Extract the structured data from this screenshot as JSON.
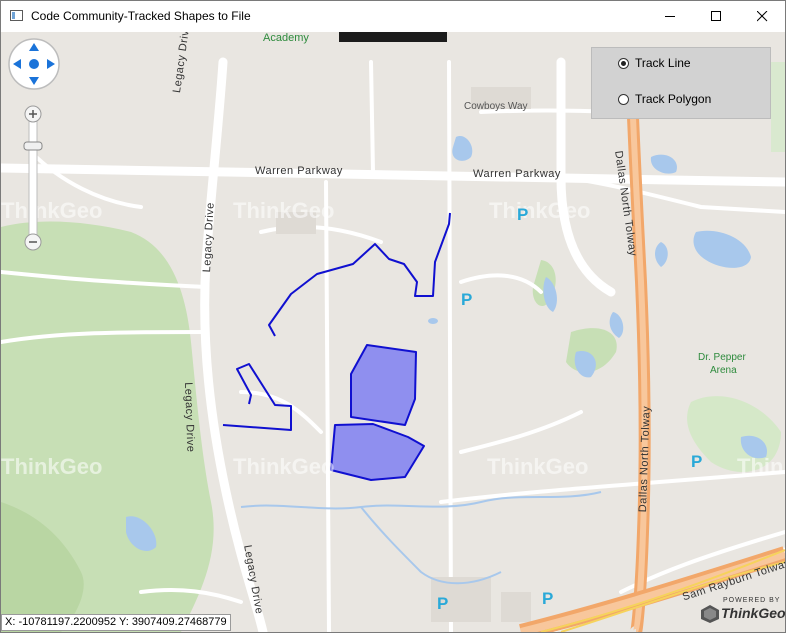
{
  "window": {
    "title": "Code Community-Tracked Shapes to File"
  },
  "track_panel": {
    "options": [
      {
        "label": "Track Line",
        "selected": true
      },
      {
        "label": "Track Polygon",
        "selected": false
      }
    ]
  },
  "map": {
    "roads": {
      "legacy_drive_1": "Legacy Drive",
      "legacy_drive_2": "Legacy Drive",
      "legacy_drive_3": "Legacy Drive",
      "legacy_drive_4": "Legacy Drive",
      "warren_parkway_1": "Warren Parkway",
      "warren_parkway_2": "Warren Parkway",
      "dallas_north_tollway_1": "Dallas North Tolway",
      "dallas_north_tollway_2": "Dallas North Tolway",
      "sam_rayburn_tollway": "Sam Rayburn Tolway",
      "cowboys_way": "Cowboys Way"
    },
    "places": {
      "academy": "Academy",
      "dr_pepper_arena_1": "Dr. Pepper",
      "dr_pepper_arena_2": "Arena"
    },
    "parking_symbol": "P",
    "watermark": "ThinkGeo",
    "track_line_color": "#1010d0",
    "track_polygon_fill": "#8f8fef"
  },
  "coordinates": {
    "text": "X: -10781197.2200952  Y: 3907409.27468779"
  },
  "logo": {
    "powered_by": "POWERED BY",
    "brand": "ThinkGeo"
  }
}
